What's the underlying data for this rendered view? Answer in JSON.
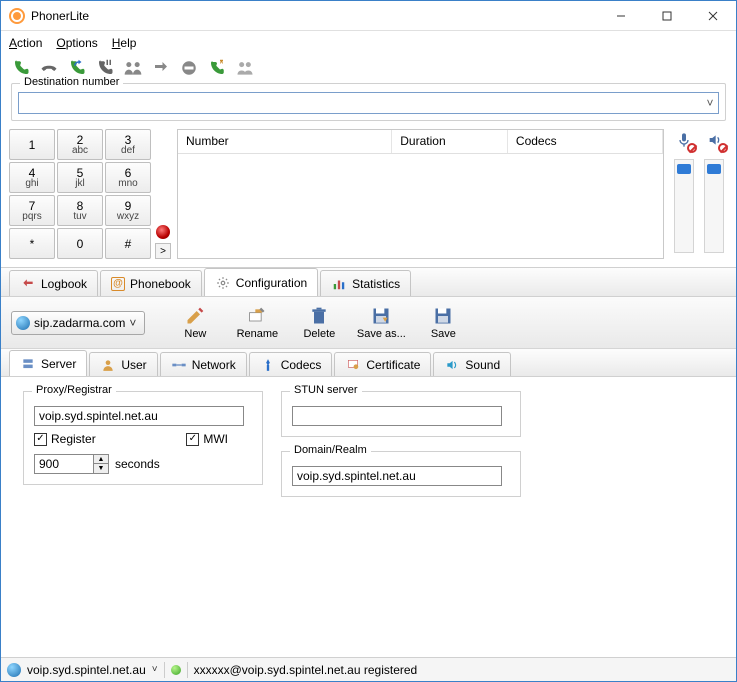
{
  "window": {
    "title": "PhonerLite"
  },
  "menu": {
    "action": "Action",
    "options": "Options",
    "help": "Help"
  },
  "destination": {
    "label": "Destination number",
    "value": ""
  },
  "dialpad": [
    {
      "num": "1",
      "sub": ""
    },
    {
      "num": "2",
      "sub": "abc"
    },
    {
      "num": "3",
      "sub": "def"
    },
    {
      "num": "4",
      "sub": "ghi"
    },
    {
      "num": "5",
      "sub": "jkl"
    },
    {
      "num": "6",
      "sub": "mno"
    },
    {
      "num": "7",
      "sub": "pqrs"
    },
    {
      "num": "8",
      "sub": "tuv"
    },
    {
      "num": "9",
      "sub": "wxyz"
    },
    {
      "num": "*",
      "sub": ""
    },
    {
      "num": "0",
      "sub": ""
    },
    {
      "num": "#",
      "sub": ""
    }
  ],
  "call_columns": {
    "number": "Number",
    "duration": "Duration",
    "codecs": "Codecs"
  },
  "tabs": {
    "logbook": "Logbook",
    "phonebook": "Phonebook",
    "configuration": "Configuration",
    "statistics": "Statistics"
  },
  "config": {
    "profile": "sip.zadarma.com",
    "buttons": {
      "new": "New",
      "rename": "Rename",
      "delete": "Delete",
      "saveas": "Save as...",
      "save": "Save"
    },
    "subtabs": {
      "server": "Server",
      "user": "User",
      "network": "Network",
      "codecs": "Codecs",
      "certificate": "Certificate",
      "sound": "Sound"
    },
    "server": {
      "proxy_label": "Proxy/Registrar",
      "proxy_value": "voip.syd.spintel.net.au",
      "register_label": "Register",
      "mwi_label": "MWI",
      "interval": "900",
      "seconds_label": "seconds",
      "stun_label": "STUN server",
      "stun_value": "",
      "domain_label": "Domain/Realm",
      "domain_value": "voip.syd.spintel.net.au"
    }
  },
  "status": {
    "server": "voip.syd.spintel.net.au",
    "message": "xxxxxx@voip.syd.spintel.net.au registered"
  }
}
